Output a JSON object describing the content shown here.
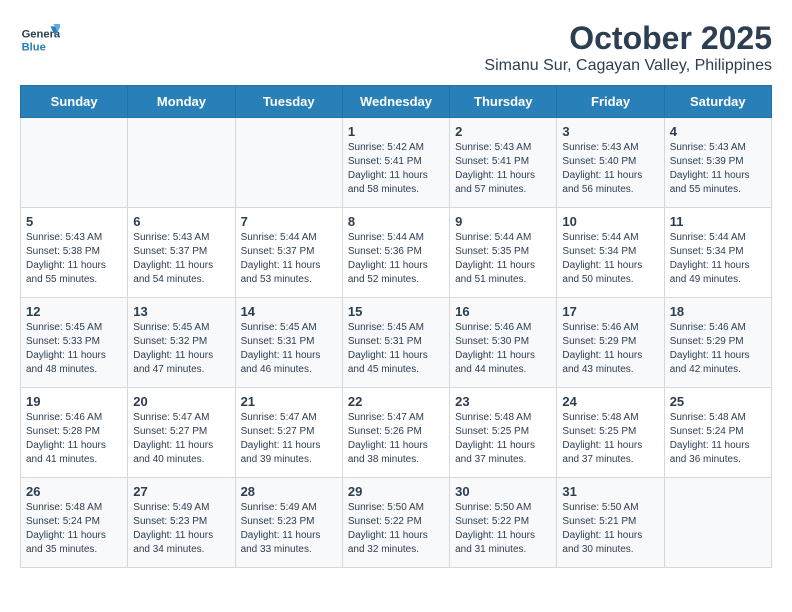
{
  "logo": {
    "general": "General",
    "blue": "Blue"
  },
  "header": {
    "month": "October 2025",
    "location": "Simanu Sur, Cagayan Valley, Philippines"
  },
  "weekdays": [
    "Sunday",
    "Monday",
    "Tuesday",
    "Wednesday",
    "Thursday",
    "Friday",
    "Saturday"
  ],
  "weeks": [
    [
      {
        "day": "",
        "info": ""
      },
      {
        "day": "",
        "info": ""
      },
      {
        "day": "",
        "info": ""
      },
      {
        "day": "1",
        "info": "Sunrise: 5:42 AM\nSunset: 5:41 PM\nDaylight: 11 hours and 58 minutes."
      },
      {
        "day": "2",
        "info": "Sunrise: 5:43 AM\nSunset: 5:41 PM\nDaylight: 11 hours and 57 minutes."
      },
      {
        "day": "3",
        "info": "Sunrise: 5:43 AM\nSunset: 5:40 PM\nDaylight: 11 hours and 56 minutes."
      },
      {
        "day": "4",
        "info": "Sunrise: 5:43 AM\nSunset: 5:39 PM\nDaylight: 11 hours and 55 minutes."
      }
    ],
    [
      {
        "day": "5",
        "info": "Sunrise: 5:43 AM\nSunset: 5:38 PM\nDaylight: 11 hours and 55 minutes."
      },
      {
        "day": "6",
        "info": "Sunrise: 5:43 AM\nSunset: 5:37 PM\nDaylight: 11 hours and 54 minutes."
      },
      {
        "day": "7",
        "info": "Sunrise: 5:44 AM\nSunset: 5:37 PM\nDaylight: 11 hours and 53 minutes."
      },
      {
        "day": "8",
        "info": "Sunrise: 5:44 AM\nSunset: 5:36 PM\nDaylight: 11 hours and 52 minutes."
      },
      {
        "day": "9",
        "info": "Sunrise: 5:44 AM\nSunset: 5:35 PM\nDaylight: 11 hours and 51 minutes."
      },
      {
        "day": "10",
        "info": "Sunrise: 5:44 AM\nSunset: 5:34 PM\nDaylight: 11 hours and 50 minutes."
      },
      {
        "day": "11",
        "info": "Sunrise: 5:44 AM\nSunset: 5:34 PM\nDaylight: 11 hours and 49 minutes."
      }
    ],
    [
      {
        "day": "12",
        "info": "Sunrise: 5:45 AM\nSunset: 5:33 PM\nDaylight: 11 hours and 48 minutes."
      },
      {
        "day": "13",
        "info": "Sunrise: 5:45 AM\nSunset: 5:32 PM\nDaylight: 11 hours and 47 minutes."
      },
      {
        "day": "14",
        "info": "Sunrise: 5:45 AM\nSunset: 5:31 PM\nDaylight: 11 hours and 46 minutes."
      },
      {
        "day": "15",
        "info": "Sunrise: 5:45 AM\nSunset: 5:31 PM\nDaylight: 11 hours and 45 minutes."
      },
      {
        "day": "16",
        "info": "Sunrise: 5:46 AM\nSunset: 5:30 PM\nDaylight: 11 hours and 44 minutes."
      },
      {
        "day": "17",
        "info": "Sunrise: 5:46 AM\nSunset: 5:29 PM\nDaylight: 11 hours and 43 minutes."
      },
      {
        "day": "18",
        "info": "Sunrise: 5:46 AM\nSunset: 5:29 PM\nDaylight: 11 hours and 42 minutes."
      }
    ],
    [
      {
        "day": "19",
        "info": "Sunrise: 5:46 AM\nSunset: 5:28 PM\nDaylight: 11 hours and 41 minutes."
      },
      {
        "day": "20",
        "info": "Sunrise: 5:47 AM\nSunset: 5:27 PM\nDaylight: 11 hours and 40 minutes."
      },
      {
        "day": "21",
        "info": "Sunrise: 5:47 AM\nSunset: 5:27 PM\nDaylight: 11 hours and 39 minutes."
      },
      {
        "day": "22",
        "info": "Sunrise: 5:47 AM\nSunset: 5:26 PM\nDaylight: 11 hours and 38 minutes."
      },
      {
        "day": "23",
        "info": "Sunrise: 5:48 AM\nSunset: 5:25 PM\nDaylight: 11 hours and 37 minutes."
      },
      {
        "day": "24",
        "info": "Sunrise: 5:48 AM\nSunset: 5:25 PM\nDaylight: 11 hours and 37 minutes."
      },
      {
        "day": "25",
        "info": "Sunrise: 5:48 AM\nSunset: 5:24 PM\nDaylight: 11 hours and 36 minutes."
      }
    ],
    [
      {
        "day": "26",
        "info": "Sunrise: 5:48 AM\nSunset: 5:24 PM\nDaylight: 11 hours and 35 minutes."
      },
      {
        "day": "27",
        "info": "Sunrise: 5:49 AM\nSunset: 5:23 PM\nDaylight: 11 hours and 34 minutes."
      },
      {
        "day": "28",
        "info": "Sunrise: 5:49 AM\nSunset: 5:23 PM\nDaylight: 11 hours and 33 minutes."
      },
      {
        "day": "29",
        "info": "Sunrise: 5:50 AM\nSunset: 5:22 PM\nDaylight: 11 hours and 32 minutes."
      },
      {
        "day": "30",
        "info": "Sunrise: 5:50 AM\nSunset: 5:22 PM\nDaylight: 11 hours and 31 minutes."
      },
      {
        "day": "31",
        "info": "Sunrise: 5:50 AM\nSunset: 5:21 PM\nDaylight: 11 hours and 30 minutes."
      },
      {
        "day": "",
        "info": ""
      }
    ]
  ]
}
